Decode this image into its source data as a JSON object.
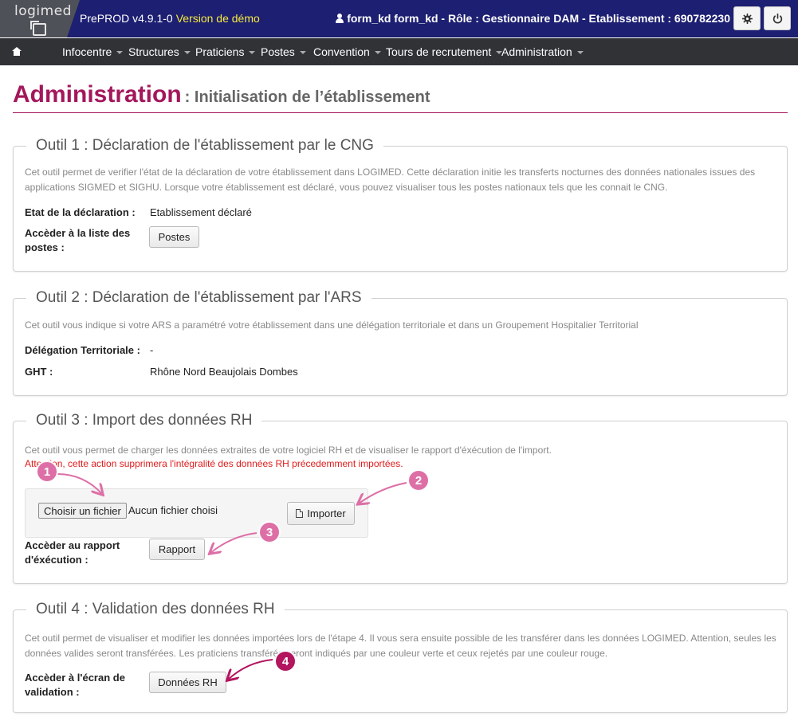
{
  "header": {
    "logo_text": "logimed",
    "version": "PrePROD v4.9.1-0",
    "demo_label": "Version de démo",
    "user_info": "form_kd form_kd - Rôle : Gestionnaire DAM - Etablissement : 690782230"
  },
  "nav": {
    "items": [
      "Infocentre",
      "Structures",
      "Praticiens",
      "Postes",
      "Convention",
      "Tours de recrutement",
      "Administration"
    ]
  },
  "page": {
    "title": "Administration",
    "subtitle": ": Initialisation de l’établissement"
  },
  "tool1": {
    "legend": "Outil 1 : Déclaration de l'établissement par le CNG",
    "description": "Cet outil permet de verifier l'état de la déclaration de votre établissement dans LOGIMED. Cette déclaration initie les transferts nocturnes des données nationales issues des applications SIGMED et SIGHU. Lorsque votre établissement est déclaré, vous pouvez visualiser tous les postes nationaux tels que les connait le CNG.",
    "status_label": "Etat de la déclaration :",
    "status_value": "Etablissement déclaré",
    "list_label": "Accèder à la liste des postes :",
    "list_button": "Postes"
  },
  "tool2": {
    "legend": "Outil 2 : Déclaration de l'établissement par l'ARS",
    "description": "Cet outil vous indique si votre ARS a paramétré votre établissement dans une délégation territoriale et dans un Groupement Hospitalier Territorial",
    "delegation_label": "Délégation Territoriale :",
    "delegation_value": "-",
    "ght_label": "GHT :",
    "ght_value": "Rhône Nord Beaujolais Dombes"
  },
  "tool3": {
    "legend": "Outil 3 : Import des données RH",
    "description": "Cet outil vous permet de charger les données extraites de votre logiciel RH et de visualiser le rapport d'éxécution de l'import.",
    "warning": "Attention, cette action supprimera l'intégralité des données RH précedemment importées.",
    "file_button": "Choisir un fichier",
    "file_status": "Aucun fichier choisi",
    "import_button": "Importer",
    "report_label": "Accèder au rapport d'éxécution :",
    "report_button": "Rapport"
  },
  "tool4": {
    "legend": "Outil 4 : Validation des données RH",
    "description": "Cet outil permet de visualiser et modifier les données importées lors de l'étape 4. Il vous sera ensuite possible de les transférer dans les données LOGIMED. Attention, seules les données valides seront transférées. Les praticiens transférés seront indiqués par une couleur verte et ceux rejetés par une couleur rouge.",
    "validation_label": "Accèder à l'écran de validation :",
    "validation_button": "Données RH"
  },
  "callouts": [
    "1",
    "2",
    "3",
    "4"
  ],
  "colors": {
    "topbar": "#1d1f72",
    "navbar": "#303236",
    "accent": "#a3175b",
    "demo": "#f6ea3d",
    "warning": "#e01b1b"
  }
}
